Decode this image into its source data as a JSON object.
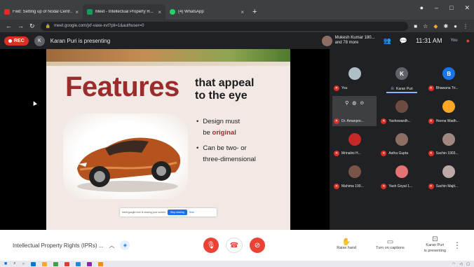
{
  "browser": {
    "tabs": [
      {
        "label": "Fwd: Setting up of Nodal Centr...",
        "color": "#d93025",
        "active": false
      },
      {
        "label": "Meet - Intellectual Property R...",
        "color": "#0f9d58",
        "active": true
      },
      {
        "label": "(4) WhatsApp",
        "color": "#25d366",
        "active": false
      }
    ],
    "new_tab": "+",
    "url": "meet.google.com/jxf-vaxe-xvt?pli=1&authuser=0",
    "window_controls": {
      "minimize": "–",
      "maximize": "□",
      "close": "✕"
    }
  },
  "meet_top": {
    "rec_label": "REC",
    "presenter_initial": "K",
    "presenting_text": "Karan Puri is presenting",
    "joined_text_1": "Mukesh Kumar 180...",
    "joined_text_2": "and 78 more",
    "clock": "11:31 AM",
    "you_label": "You"
  },
  "slide": {
    "title": "Features",
    "subtitle_1": "that appeal",
    "subtitle_2": "to the eye",
    "bullet_1a": "Design must",
    "bullet_1b_prefix": "be ",
    "bullet_1b_em": "original",
    "bullet_2a": "Can be two- or",
    "bullet_2b": "three-dimensional",
    "share_text": "meet.google.com is sharing your screen",
    "stop_label": "Stop sharing",
    "hide_label": "Hide"
  },
  "participants": [
    {
      "name": "You",
      "initial": "",
      "color": "#b0bec5",
      "mic_off": true
    },
    {
      "name": "Karan Puri",
      "initial": "K",
      "color": "#5f6368",
      "mic_off": false,
      "speaking": true
    },
    {
      "name": "Bhawana Tri...",
      "initial": "B",
      "color": "#1a73e8",
      "mic_off": true
    },
    {
      "name": "Dr. Amanpre...",
      "initial": "",
      "color": "#3c4043",
      "mic_off": true,
      "hover": true
    },
    {
      "name": "Yashowardh...",
      "initial": "",
      "color": "#6d4c41",
      "mic_off": true
    },
    {
      "name": "Heena Wadh...",
      "initial": "",
      "color": "#f9a825",
      "mic_off": true
    },
    {
      "name": "Mrinalini H...",
      "initial": "",
      "color": "#c62828",
      "mic_off": true
    },
    {
      "name": "Astha Gupta",
      "initial": "",
      "color": "#8d6e63",
      "mic_off": true
    },
    {
      "name": "Sachin 1903...",
      "initial": "",
      "color": "#a1887f",
      "mic_off": true
    },
    {
      "name": "Mahima 190...",
      "initial": "",
      "color": "#795548",
      "mic_off": true
    },
    {
      "name": "Yash Goyal 1...",
      "initial": "",
      "color": "#e57373",
      "mic_off": true
    },
    {
      "name": "Sachin Majit...",
      "initial": "",
      "color": "#bcaaa4",
      "mic_off": true
    }
  ],
  "bottom": {
    "meeting_name": "Intellectual Property Rights (IPRs) ...",
    "actions": [
      {
        "icon": "✋",
        "label_1": "Raise hand",
        "label_2": ""
      },
      {
        "icon": "▭",
        "label_1": "Turn on captions",
        "label_2": ""
      },
      {
        "icon": "⊡",
        "label_1": "Karan Puri",
        "label_2": "is presenting"
      }
    ]
  },
  "colors": {
    "accent": "#1a73e8",
    "danger": "#ea4335",
    "slide_title": "#9b2c2c"
  }
}
